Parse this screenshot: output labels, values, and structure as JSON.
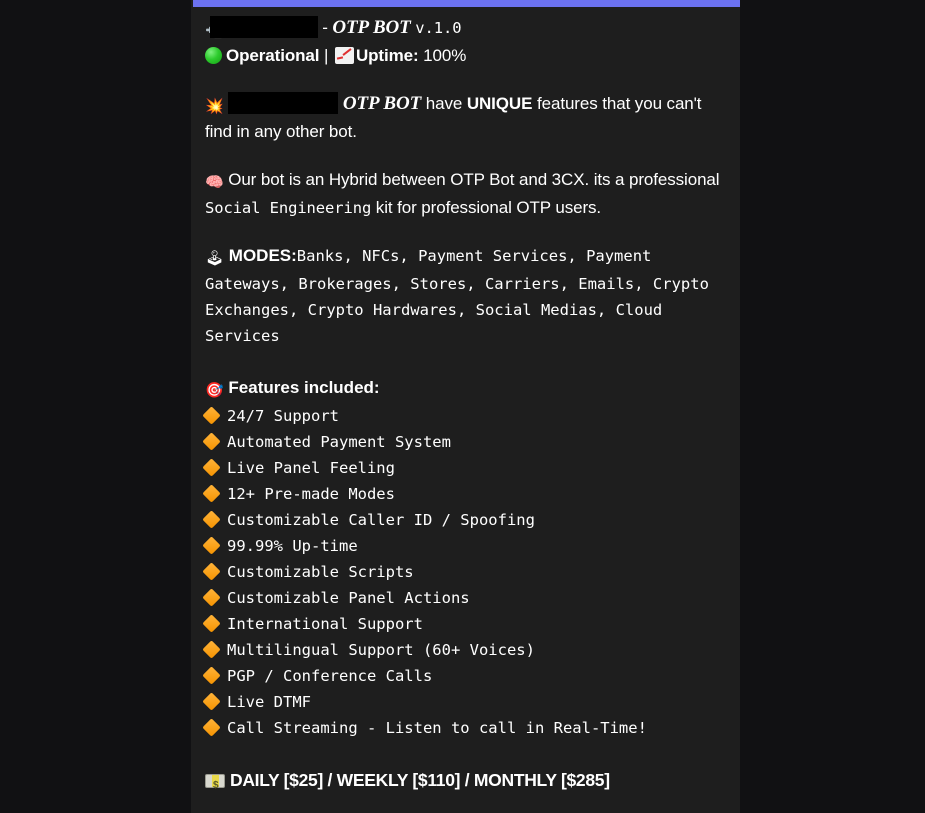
{
  "theme": {
    "page_background": "#111113",
    "panel_background": "#1e1e1e",
    "accent_bar_color": "#6c72f0",
    "text_color": "#ffffff",
    "bullet_color": "#f59300",
    "status_color": "#2ecc2e"
  },
  "header": {
    "phone_icon": "phone-with-arrow-icon",
    "redacted_brand": "",
    "separator": " - ",
    "product_name": "OTP BOT",
    "version": "v.1.0",
    "status_icon": "green-circle-icon",
    "status_label": "Operational",
    "divider": "|",
    "uptime_icon": "chart-increasing-icon",
    "uptime_label": "Uptime:",
    "uptime_value": "100%"
  },
  "tagline": {
    "icon": "collision-icon",
    "redacted_brand": "",
    "product_name": "OTP BOT",
    "text_before_unique": " have ",
    "unique_word": "UNIQUE",
    "text_after_unique": " features that you can't find in any other bot."
  },
  "description": {
    "icon": "brain-icon",
    "part1": "Our bot is an Hybrid between OTP Bot and 3CX. its a professional ",
    "code_phrase": "Social Engineering",
    "part2": " kit for professional OTP users."
  },
  "modes": {
    "icon": "joystick-icon",
    "label": "MODES:",
    "items": "Banks, NFCs, Payment Services, Payment Gateways, Brokerages, Stores, Carriers, Emails, Crypto Exchanges, Crypto Hardwares, Social Medias, Cloud Services"
  },
  "features": {
    "icon": "dart-target-icon",
    "heading": "Features included:",
    "bullet_icon": "orange-diamond-icon",
    "items": [
      "24/7 Support",
      "Automated Payment System",
      "Live Panel Feeling",
      "12+ Pre-made Modes",
      "Customizable Caller ID / Spoofing",
      "99.99% Up-time",
      "Customizable Scripts",
      "Customizable Panel Actions",
      "International Support",
      "Multilingual Support (60+ Voices)",
      "PGP / Conference Calls",
      "Live DTMF",
      "Call Streaming - Listen to call in Real-Time!"
    ]
  },
  "pricing": {
    "icon": "dollar-banknote-icon",
    "text": "DAILY [$25] / WEEKLY [$110] / MONTHLY [$285]"
  }
}
